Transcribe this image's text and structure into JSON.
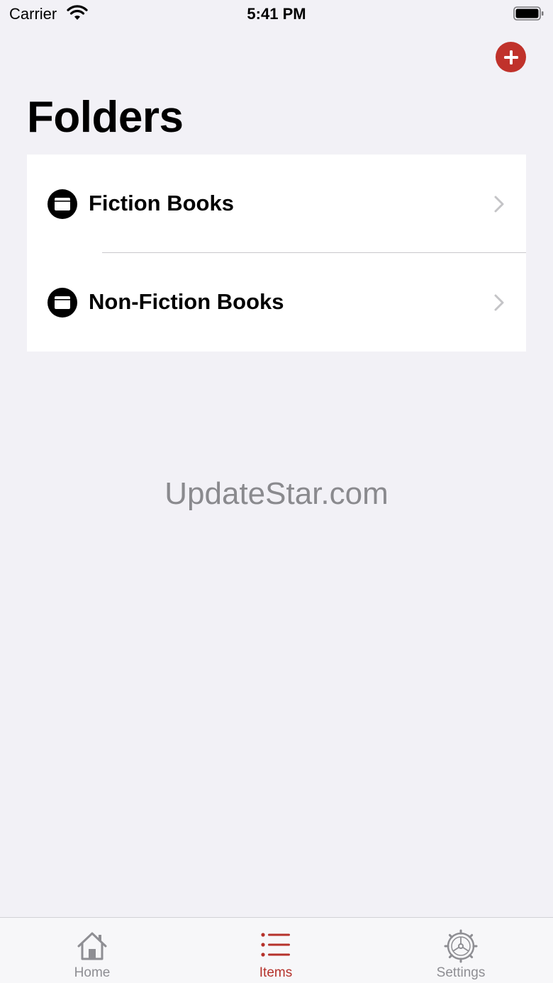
{
  "status_bar": {
    "carrier": "Carrier",
    "time": "5:41 PM"
  },
  "header": {
    "title": "Folders",
    "add_icon": "plus-circle-icon",
    "accent_color": "#c0322b"
  },
  "folders": [
    {
      "label": "Fiction Books",
      "icon": "folder-icon"
    },
    {
      "label": "Non-Fiction Books",
      "icon": "folder-icon"
    }
  ],
  "watermark": "UpdateStar.com",
  "tab_bar": {
    "active": "Items",
    "tabs": [
      {
        "label": "Home",
        "icon": "house-icon"
      },
      {
        "label": "Items",
        "icon": "list-icon"
      },
      {
        "label": "Settings",
        "icon": "gear-icon"
      }
    ]
  }
}
